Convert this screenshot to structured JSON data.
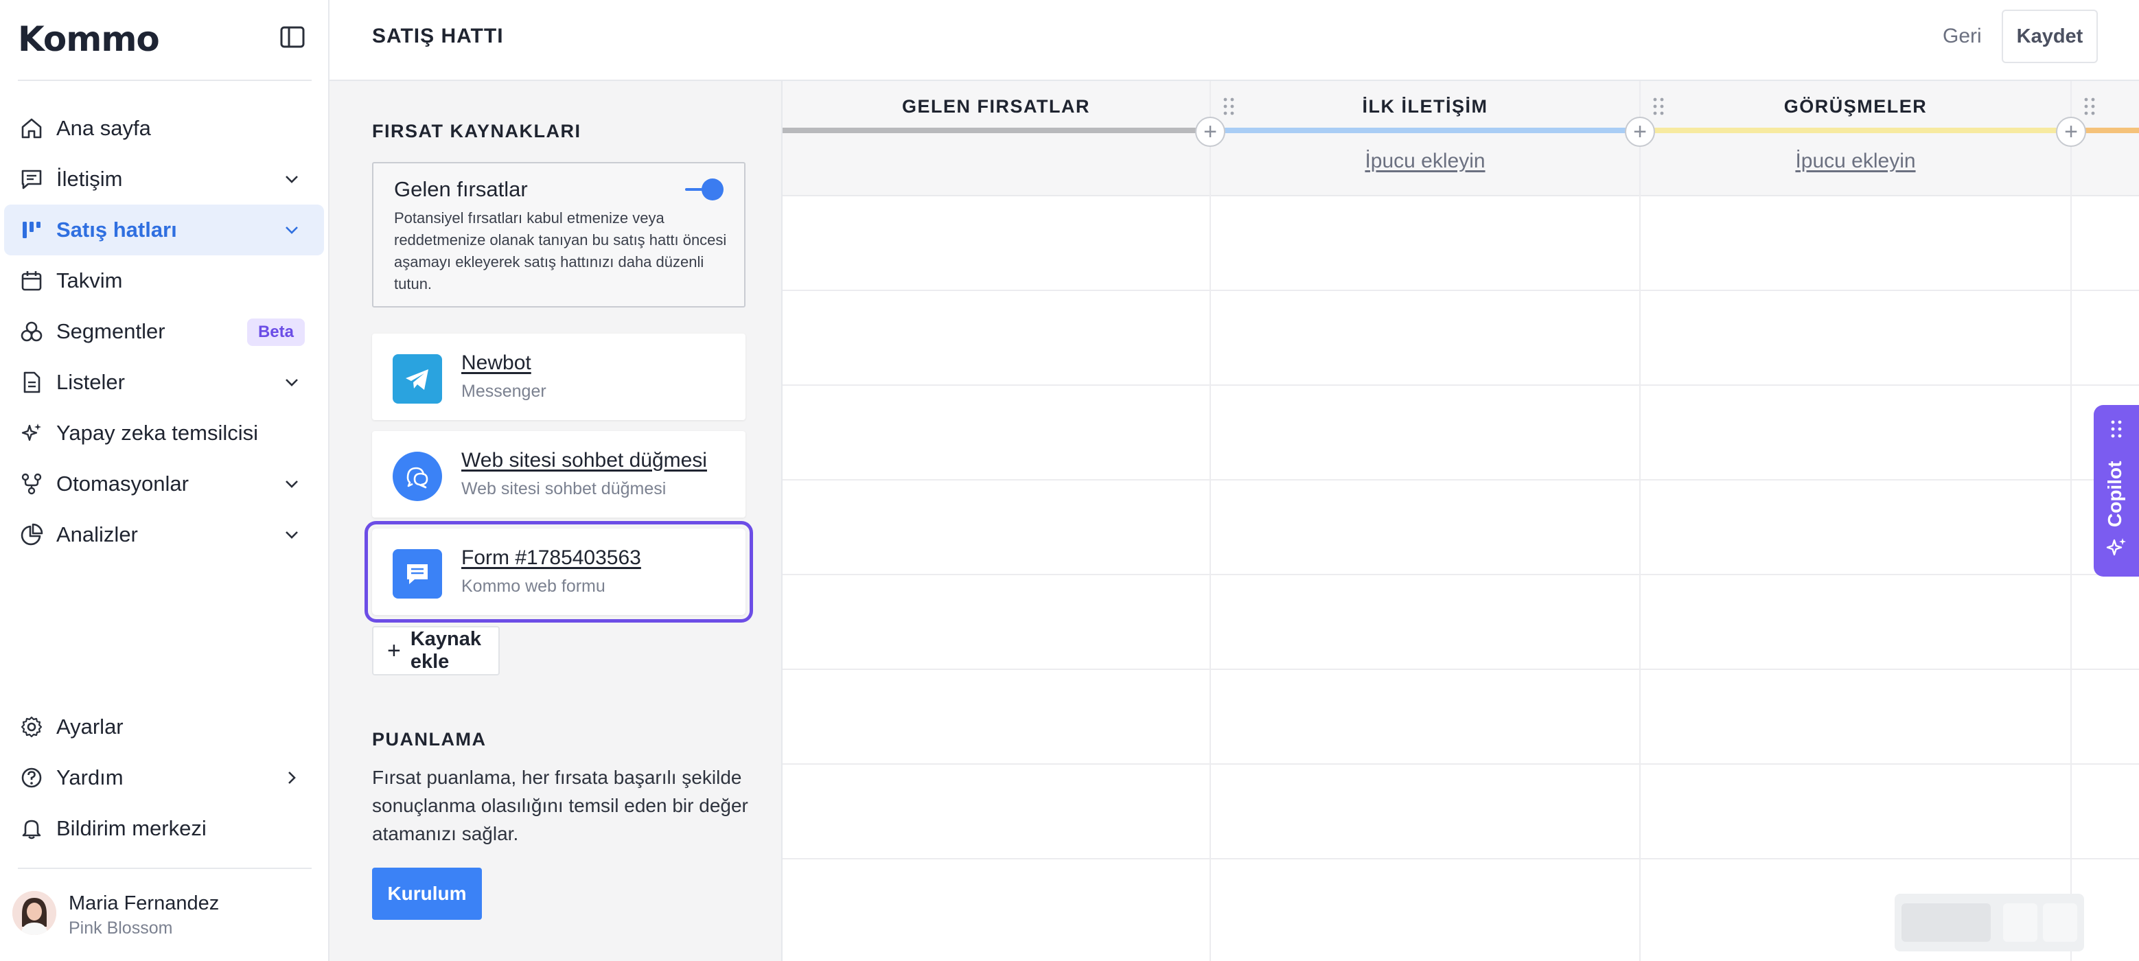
{
  "brand": {
    "logo_text": "Kommo"
  },
  "sidebar": {
    "items": [
      {
        "label": "Ana sayfa",
        "icon": "home-icon"
      },
      {
        "label": "İletişim",
        "icon": "chat-icon",
        "chevron": "down"
      },
      {
        "label": "Satış hatları",
        "icon": "pipeline-icon",
        "chevron": "down",
        "active": true
      },
      {
        "label": "Takvim",
        "icon": "calendar-icon"
      },
      {
        "label": "Segmentler",
        "icon": "segments-icon",
        "badge": "Beta"
      },
      {
        "label": "Listeler",
        "icon": "document-icon",
        "chevron": "down"
      },
      {
        "label": "Yapay zeka temsilcisi",
        "icon": "sparkle-icon"
      },
      {
        "label": "Otomasyonlar",
        "icon": "flow-icon",
        "chevron": "down"
      },
      {
        "label": "Analizler",
        "icon": "pie-chart-icon",
        "chevron": "down"
      }
    ],
    "bottom_items": [
      {
        "label": "Ayarlar",
        "icon": "gear-icon"
      },
      {
        "label": "Yardım",
        "icon": "help-icon",
        "chevron": "right"
      },
      {
        "label": "Bildirim merkezi",
        "icon": "bell-icon"
      }
    ],
    "user": {
      "name": "Maria Fernandez",
      "org": "Pink Blossom"
    }
  },
  "panel": {
    "title": "SATIŞ HATTI",
    "sources_title": "FIRSAT KAYNAKLARI",
    "incoming": {
      "title": "Gelen fırsatlar",
      "toggle_on": true,
      "description": "Potansiyel fırsatları kabul etmenize veya reddetmenize olanak tanıyan bu satış hattı öncesi aşamayı ekleyerek satış hattınızı daha düzenli tutun."
    },
    "sources": [
      {
        "name": "Newbot",
        "sub": "Messenger",
        "icon": "telegram-icon",
        "color": "#2aa3df"
      },
      {
        "name": "Web sitesi sohbet düğmesi",
        "sub": "Web sitesi sohbet düğmesi",
        "icon": "chat-bubbles-icon",
        "color": "#3b82f6"
      },
      {
        "name": "Form #1785403563",
        "sub": "Kommo web formu",
        "icon": "form-icon",
        "color": "#3b82f6",
        "selected": true
      }
    ],
    "add_source_label": "Kaynak ekle",
    "scoring_title": "PUANLAMA",
    "scoring_desc": "Fırsat puanlama, her fırsata başarılı şekilde sonuçlanma olasılığını temsil eden bir değer atamanızı sağlar.",
    "setup_label": "Kurulum"
  },
  "board": {
    "back_label": "Geri",
    "save_label": "Kaydet",
    "columns": [
      {
        "title": "GELEN FIRSATLAR",
        "hint": "",
        "color": "#b8b9bc"
      },
      {
        "title": "İLK İLETİŞİM",
        "hint": "İpucu ekleyin",
        "color": "#a9cdf5"
      },
      {
        "title": "GÖRÜŞMELER",
        "hint": "İpucu ekleyin",
        "color": "#f7eaa0"
      }
    ],
    "copilot_label": "Copilot"
  },
  "colors": {
    "accent": "#3b82f6",
    "selected_outline": "#6c4de6",
    "copilot": "#7b5cf0"
  }
}
